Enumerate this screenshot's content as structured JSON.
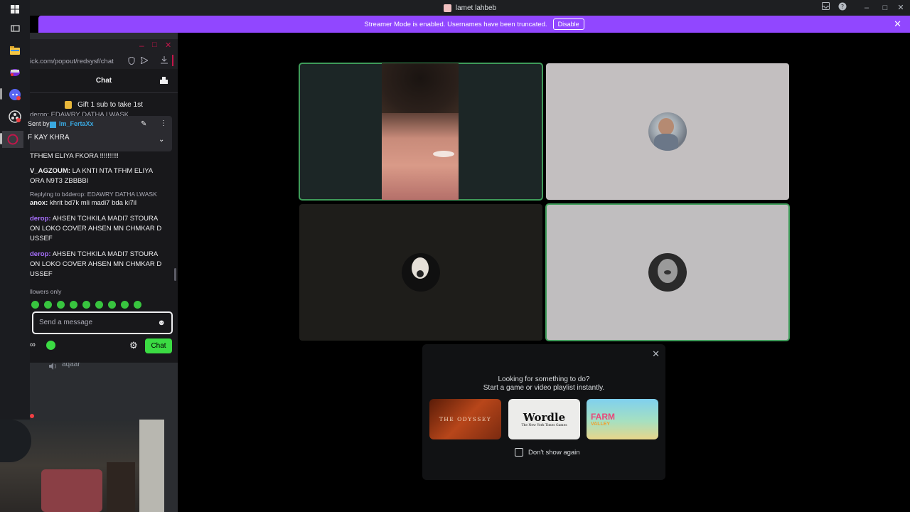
{
  "window": {
    "title": "lamet lahbeb"
  },
  "banner": {
    "text": "Streamer Mode is enabled. Usernames have been truncated.",
    "disable_label": "Disable"
  },
  "chat": {
    "url": "ick.com/popout/redsysf/chat",
    "header": "Chat",
    "gift_text": "Gift 1 sub to take 1st",
    "top_clipped": "derop: EDAWRY DATHA LWASK",
    "pinned": {
      "sent_by": "Sent by",
      "user": "Im_FertaXx",
      "text": "F KAY KHRA"
    },
    "messages": [
      {
        "user": "",
        "text": "TFHEM ELIYA FKORA !!!!!!!!!!"
      },
      {
        "user": "V_AGZOUM:",
        "text": "LA KNTI NTA TFHM ELIYA"
      },
      {
        "user": "",
        "text": "ORA N9T3 ZBBBBI"
      },
      {
        "user": "",
        "text": "Replying to b4derop: EDAWRY DATHA LWASK"
      },
      {
        "user": "anox:",
        "text": "khrit bd7k mli madi7 bda ki7il"
      },
      {
        "user": "derop:",
        "text": "AHSEN TCHKILA MADI7 STOURA"
      },
      {
        "user": "",
        "text": "ON LOKO COVER AHSEN MN CHMKAR D"
      },
      {
        "user": "",
        "text": "USSEF"
      },
      {
        "user": "derop:",
        "text": "AHSEN TCHKILA MADI7 STOURA"
      },
      {
        "user": "",
        "text": "ON LOKO COVER AHSEN MN CHMKAR D"
      },
      {
        "user": "",
        "text": "USSEF"
      }
    ],
    "followers_only": "llowers only",
    "input_placeholder": "Send a message",
    "chat_button": "Chat"
  },
  "voice_sidebar": {
    "user": "aqaar"
  },
  "activity": {
    "line1": "Looking for something to do?",
    "line2": "Start a game or video playlist instantly.",
    "games": [
      {
        "name": "THE ODYSSEY"
      },
      {
        "name": "Wordle",
        "subtitle": "The New York Times Games"
      },
      {
        "name": "FARM",
        "subtitle": "VALLEY"
      }
    ],
    "dont_show": "Don't show again"
  },
  "colors": {
    "accent_purple": "#9147ff",
    "speaking_green": "#3f9c5a",
    "chat_green": "#3bdb43"
  }
}
